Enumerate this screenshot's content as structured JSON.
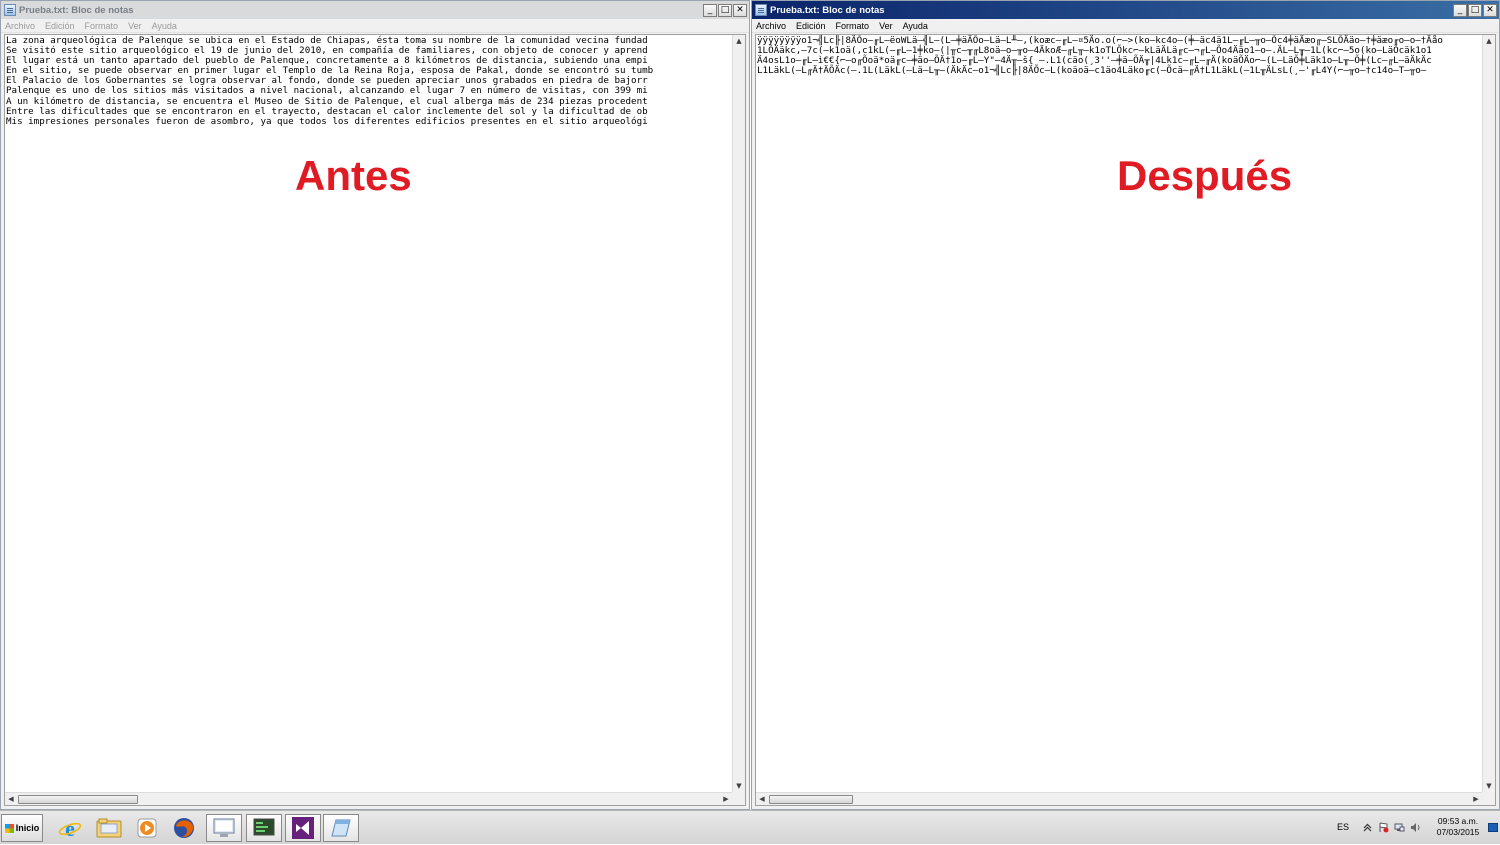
{
  "left_window": {
    "title": "Prueba.txt: Bloc de notas",
    "menu": [
      "Archivo",
      "Edición",
      "Formato",
      "Ver",
      "Ayuda"
    ],
    "lines": [
      "La zona arqueológica de Palenque se ubica en el Estado de Chiapas, ésta toma su nombre de la comunidad vecina fundad",
      "Se visitó este sitio arqueológico el 19 de junio del 2010, en compañía de familiares, con objeto de conocer y aprend",
      "El lugar está un tanto apartado del pueblo de Palenque, concretamente a 8 kilómetros de distancia, subiendo una empi",
      "En el sitio, se puede observar en primer lugar el Templo de la Reina Roja, esposa de Pakal, donde se encontró su tumb",
      "El Palacio de los Gobernantes se logra observar al fondo, donde se pueden apreciar unos grabados en piedra de bajorr",
      "Palenque es uno de los sitios más visitados a nivel nacional, alcanzando el lugar 7 en número de visitas, con 399 mi",
      "A un kilómetro de distancia, se encuentra el Museo de Sitio de Palenque, el cual alberga más de 234 piezas procedent",
      "Entre las dificultades que se encontraron en el trayecto, destacan el calor inclemente del sol y la dificultad de ob",
      "Mis impresiones personales fueron de asombro, ya que todos los diferentes edificios presentes en el sitio arqueológi"
    ]
  },
  "right_window": {
    "title": "Prueba.txt: Bloc de notas",
    "menu": [
      "Archivo",
      "Edición",
      "Formato",
      "Ver",
      "Ayuda"
    ],
    "lines": [
      "ÿÿÿÿÿÿÿÿo1¬╣Lc╟|8ÄÕo–╓L–ëoWLä–╣L–(L–╪äÄÕo–Lä–L╨–,(koæc–╓L–¤5Äo.o(⌐–>(ko–kc4o–(╪–äc4ä1L–╓L–╥o–Õc4╪äÄæo╓–SLÕÄäo–†╪äæo╓o–o–†Äåo",
      "1LÕÄäkc,–7c(–k1oä(,c1kL(–╓L–1╪ko–(|╥c–╥╓L8oä–o–╥o–4ÄkoÆ–╓L╥–k1oTLÕkc⌐–kLäÄLä╓c–¬╓L–Õo4Ääo1–o–.ÄL–L╥–1L(kc⌐–5o(ko–LäÕcäk1o1",
      "Ä4osL1o–╓L–ì€€{⌐–o╓Õoä*oä╓c–╪äo–ÕÄ†1o–╓L–Y\"–4Ä╥–š{ –.L1(cäo(¸3''–╪ä–ÕÄ╥|4Lk1c–╓L–╓Ä(koäÕÄo⌐–(L–LäÕ╪Läk1o–L╥–Õ╪(Lc–╓L–äÄkÄc",
      "L1LäkL(–L╓Ä†ÄÕÄc(–.1L(LäkL(–Lä–L╥–(ÄkÄc–o1¬╣Lc╟|8ÄÕc–L(koäoä–c1äo4Läko╓c(–Õcä–╓Ä†L1LäkL(–1L╥ÄLsL(¸–'╓L4Y(⌐–╥o–†c14o–T–╥o–"
    ]
  },
  "labels": {
    "before": "Antes",
    "after": "Después"
  },
  "taskbar": {
    "start_label": "Inicio",
    "language": "ES",
    "time": "09:53 a.m.",
    "date": "07/03/2015"
  },
  "colors": {
    "label_red": "#e01b24",
    "active_title": "#0a246a"
  }
}
